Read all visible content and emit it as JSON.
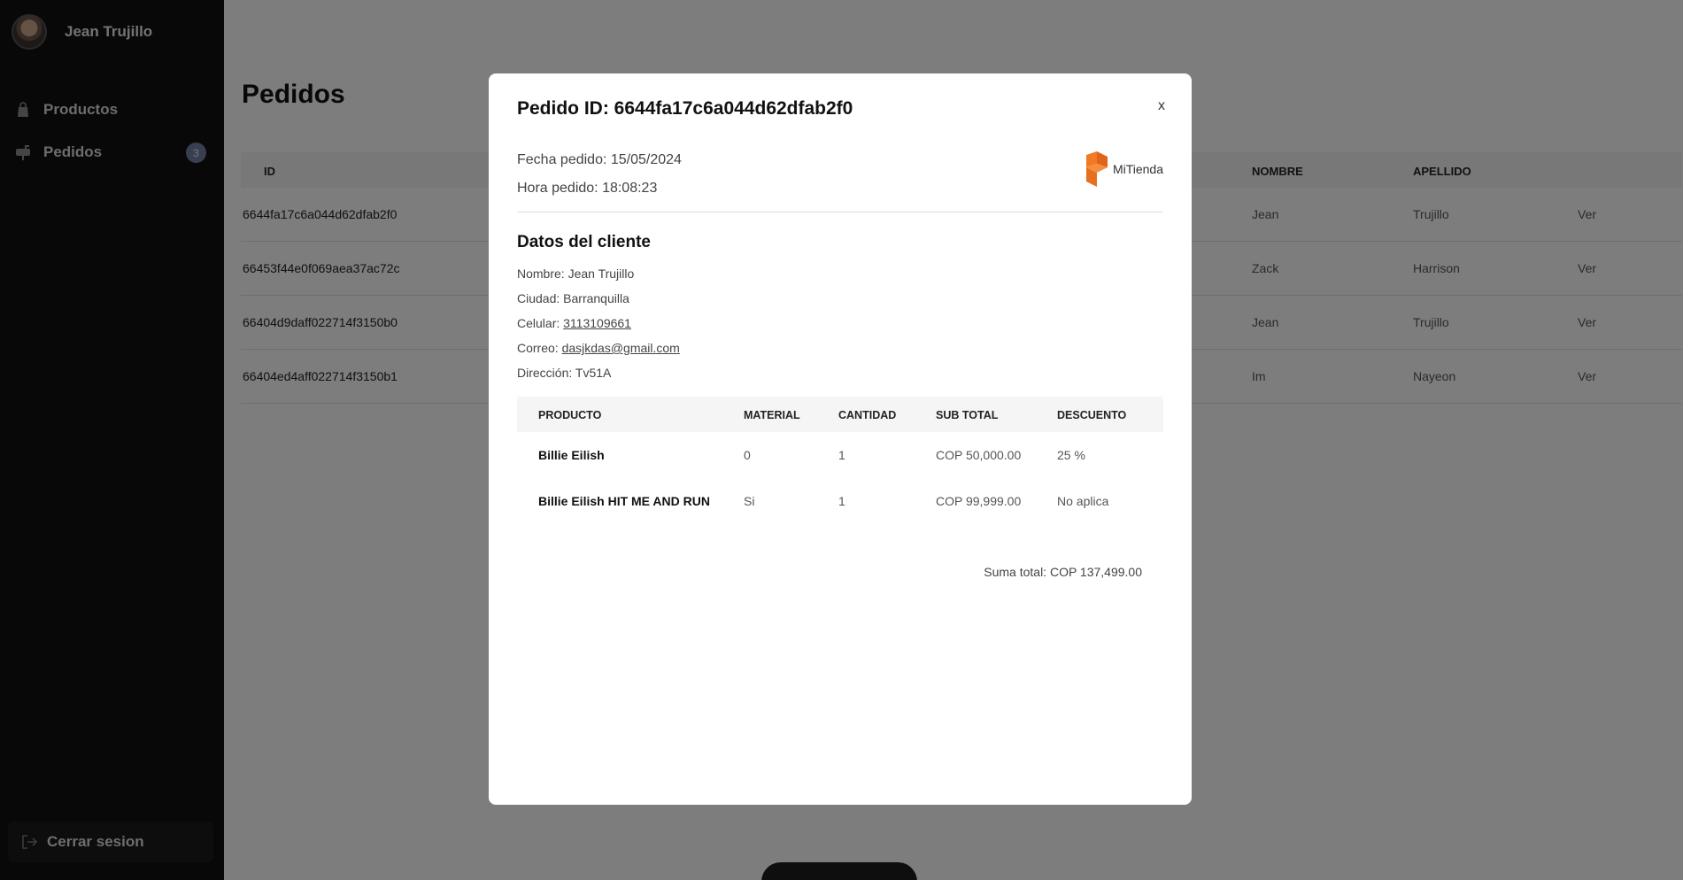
{
  "sidebar": {
    "user_name": "Jean Trujillo",
    "items": [
      {
        "label": "Productos",
        "icon": "shopping-bag-icon"
      },
      {
        "label": "Pedidos",
        "icon": "mailbox-icon",
        "badge": "3"
      }
    ],
    "logout_label": "Cerrar sesion"
  },
  "page": {
    "title": "Pedidos",
    "table": {
      "columns": [
        "ID",
        "NOMBRE",
        "APELLIDO"
      ],
      "rows": [
        {
          "id": "6644fa17c6a044d62dfab2f0",
          "nombre": "Jean",
          "apellido": "Trujillo",
          "action": "Ver"
        },
        {
          "id": "66453f44e0f069aea37ac72c",
          "nombre": "Zack",
          "apellido": "Harrison",
          "action": "Ver"
        },
        {
          "id": "66404d9daff022714f3150b0",
          "nombre": "Jean",
          "apellido": "Trujillo",
          "action": "Ver"
        },
        {
          "id": "66404ed4aff022714f3150b1",
          "nombre": "Im",
          "apellido": "Nayeon",
          "action": "Ver"
        }
      ]
    }
  },
  "modal": {
    "title": "Pedido ID: 6644fa17c6a044d62dfab2f0",
    "close_label": "x",
    "fecha": "Fecha pedido: 15/05/2024",
    "hora": "Hora pedido: 18:08:23",
    "brand": {
      "name": "MiTienda",
      "color": "#f27a24"
    },
    "client_section_title": "Datos del cliente",
    "client": {
      "nombre_label": "Nombre: ",
      "nombre": "Jean Trujillo",
      "ciudad_label": "Ciudad: ",
      "ciudad": "Barranquilla",
      "celular_label": "Celular: ",
      "celular": "3113109661",
      "correo_label": "Correo: ",
      "correo": "dasjkdas@gmail.com",
      "direccion_label": "Dirección: ",
      "direccion": "Tv51A"
    },
    "items_table": {
      "columns": [
        "PRODUCTO",
        "MATERIAL",
        "CANTIDAD",
        "SUB TOTAL",
        "DESCUENTO"
      ],
      "rows": [
        {
          "producto": "Billie Eilish",
          "material": "0",
          "cantidad": "1",
          "subtotal": "COP 50,000.00",
          "descuento": "25 %"
        },
        {
          "producto": "Billie Eilish HIT ME AND RUN",
          "material": "Si",
          "cantidad": "1",
          "subtotal": "COP 99,999.00",
          "descuento": "No aplica"
        }
      ]
    },
    "total": "Suma total: COP 137,499.00"
  }
}
